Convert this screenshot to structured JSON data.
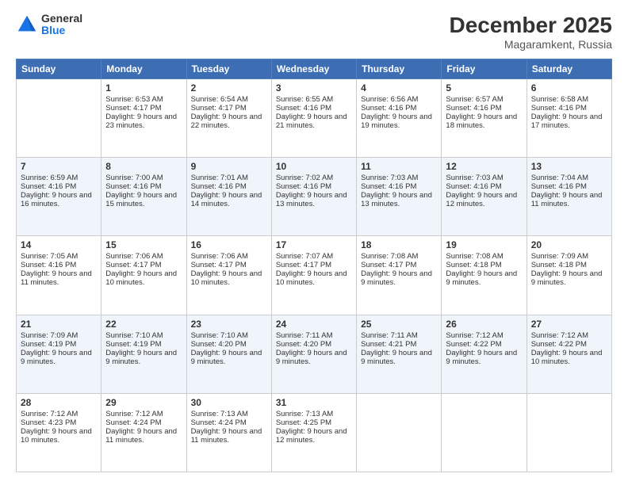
{
  "logo": {
    "general": "General",
    "blue": "Blue"
  },
  "title": "December 2025",
  "subtitle": "Magaramkent, Russia",
  "days_of_week": [
    "Sunday",
    "Monday",
    "Tuesday",
    "Wednesday",
    "Thursday",
    "Friday",
    "Saturday"
  ],
  "weeks": [
    {
      "shaded": false,
      "cells": [
        {
          "day": "",
          "empty": true
        },
        {
          "day": "1",
          "sunrise": "Sunrise: 6:53 AM",
          "sunset": "Sunset: 4:17 PM",
          "daylight": "Daylight: 9 hours and 23 minutes."
        },
        {
          "day": "2",
          "sunrise": "Sunrise: 6:54 AM",
          "sunset": "Sunset: 4:17 PM",
          "daylight": "Daylight: 9 hours and 22 minutes."
        },
        {
          "day": "3",
          "sunrise": "Sunrise: 6:55 AM",
          "sunset": "Sunset: 4:16 PM",
          "daylight": "Daylight: 9 hours and 21 minutes."
        },
        {
          "day": "4",
          "sunrise": "Sunrise: 6:56 AM",
          "sunset": "Sunset: 4:16 PM",
          "daylight": "Daylight: 9 hours and 19 minutes."
        },
        {
          "day": "5",
          "sunrise": "Sunrise: 6:57 AM",
          "sunset": "Sunset: 4:16 PM",
          "daylight": "Daylight: 9 hours and 18 minutes."
        },
        {
          "day": "6",
          "sunrise": "Sunrise: 6:58 AM",
          "sunset": "Sunset: 4:16 PM",
          "daylight": "Daylight: 9 hours and 17 minutes."
        }
      ]
    },
    {
      "shaded": true,
      "cells": [
        {
          "day": "7",
          "sunrise": "Sunrise: 6:59 AM",
          "sunset": "Sunset: 4:16 PM",
          "daylight": "Daylight: 9 hours and 16 minutes."
        },
        {
          "day": "8",
          "sunrise": "Sunrise: 7:00 AM",
          "sunset": "Sunset: 4:16 PM",
          "daylight": "Daylight: 9 hours and 15 minutes."
        },
        {
          "day": "9",
          "sunrise": "Sunrise: 7:01 AM",
          "sunset": "Sunset: 4:16 PM",
          "daylight": "Daylight: 9 hours and 14 minutes."
        },
        {
          "day": "10",
          "sunrise": "Sunrise: 7:02 AM",
          "sunset": "Sunset: 4:16 PM",
          "daylight": "Daylight: 9 hours and 13 minutes."
        },
        {
          "day": "11",
          "sunrise": "Sunrise: 7:03 AM",
          "sunset": "Sunset: 4:16 PM",
          "daylight": "Daylight: 9 hours and 13 minutes."
        },
        {
          "day": "12",
          "sunrise": "Sunrise: 7:03 AM",
          "sunset": "Sunset: 4:16 PM",
          "daylight": "Daylight: 9 hours and 12 minutes."
        },
        {
          "day": "13",
          "sunrise": "Sunrise: 7:04 AM",
          "sunset": "Sunset: 4:16 PM",
          "daylight": "Daylight: 9 hours and 11 minutes."
        }
      ]
    },
    {
      "shaded": false,
      "cells": [
        {
          "day": "14",
          "sunrise": "Sunrise: 7:05 AM",
          "sunset": "Sunset: 4:16 PM",
          "daylight": "Daylight: 9 hours and 11 minutes."
        },
        {
          "day": "15",
          "sunrise": "Sunrise: 7:06 AM",
          "sunset": "Sunset: 4:17 PM",
          "daylight": "Daylight: 9 hours and 10 minutes."
        },
        {
          "day": "16",
          "sunrise": "Sunrise: 7:06 AM",
          "sunset": "Sunset: 4:17 PM",
          "daylight": "Daylight: 9 hours and 10 minutes."
        },
        {
          "day": "17",
          "sunrise": "Sunrise: 7:07 AM",
          "sunset": "Sunset: 4:17 PM",
          "daylight": "Daylight: 9 hours and 10 minutes."
        },
        {
          "day": "18",
          "sunrise": "Sunrise: 7:08 AM",
          "sunset": "Sunset: 4:17 PM",
          "daylight": "Daylight: 9 hours and 9 minutes."
        },
        {
          "day": "19",
          "sunrise": "Sunrise: 7:08 AM",
          "sunset": "Sunset: 4:18 PM",
          "daylight": "Daylight: 9 hours and 9 minutes."
        },
        {
          "day": "20",
          "sunrise": "Sunrise: 7:09 AM",
          "sunset": "Sunset: 4:18 PM",
          "daylight": "Daylight: 9 hours and 9 minutes."
        }
      ]
    },
    {
      "shaded": true,
      "cells": [
        {
          "day": "21",
          "sunrise": "Sunrise: 7:09 AM",
          "sunset": "Sunset: 4:19 PM",
          "daylight": "Daylight: 9 hours and 9 minutes."
        },
        {
          "day": "22",
          "sunrise": "Sunrise: 7:10 AM",
          "sunset": "Sunset: 4:19 PM",
          "daylight": "Daylight: 9 hours and 9 minutes."
        },
        {
          "day": "23",
          "sunrise": "Sunrise: 7:10 AM",
          "sunset": "Sunset: 4:20 PM",
          "daylight": "Daylight: 9 hours and 9 minutes."
        },
        {
          "day": "24",
          "sunrise": "Sunrise: 7:11 AM",
          "sunset": "Sunset: 4:20 PM",
          "daylight": "Daylight: 9 hours and 9 minutes."
        },
        {
          "day": "25",
          "sunrise": "Sunrise: 7:11 AM",
          "sunset": "Sunset: 4:21 PM",
          "daylight": "Daylight: 9 hours and 9 minutes."
        },
        {
          "day": "26",
          "sunrise": "Sunrise: 7:12 AM",
          "sunset": "Sunset: 4:22 PM",
          "daylight": "Daylight: 9 hours and 9 minutes."
        },
        {
          "day": "27",
          "sunrise": "Sunrise: 7:12 AM",
          "sunset": "Sunset: 4:22 PM",
          "daylight": "Daylight: 9 hours and 10 minutes."
        }
      ]
    },
    {
      "shaded": false,
      "cells": [
        {
          "day": "28",
          "sunrise": "Sunrise: 7:12 AM",
          "sunset": "Sunset: 4:23 PM",
          "daylight": "Daylight: 9 hours and 10 minutes."
        },
        {
          "day": "29",
          "sunrise": "Sunrise: 7:12 AM",
          "sunset": "Sunset: 4:24 PM",
          "daylight": "Daylight: 9 hours and 11 minutes."
        },
        {
          "day": "30",
          "sunrise": "Sunrise: 7:13 AM",
          "sunset": "Sunset: 4:24 PM",
          "daylight": "Daylight: 9 hours and 11 minutes."
        },
        {
          "day": "31",
          "sunrise": "Sunrise: 7:13 AM",
          "sunset": "Sunset: 4:25 PM",
          "daylight": "Daylight: 9 hours and 12 minutes."
        },
        {
          "day": "",
          "empty": true
        },
        {
          "day": "",
          "empty": true
        },
        {
          "day": "",
          "empty": true
        }
      ]
    }
  ]
}
